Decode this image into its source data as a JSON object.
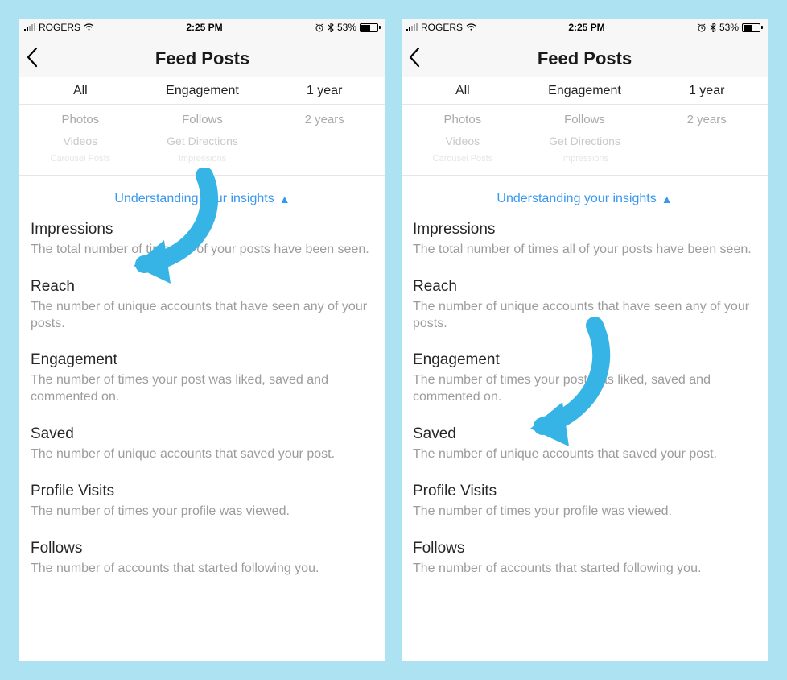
{
  "statusBar": {
    "carrier": "ROGERS",
    "time": "2:25 PM",
    "battery": "53%"
  },
  "header": {
    "title": "Feed Posts"
  },
  "filters": {
    "col1": "All",
    "col2": "Engagement",
    "col3": "1 year"
  },
  "picker": {
    "col1": {
      "line1": "Photos",
      "line2": "Videos",
      "line3": "Carousel Posts"
    },
    "col2": {
      "line1": "Follows",
      "line2": "Get Directions",
      "line3": "Impressions"
    },
    "col3": {
      "line1": "2 years",
      "line2": "",
      "line3": ""
    }
  },
  "insightsLink": "Understanding your insights",
  "definitions": [
    {
      "title": "Impressions",
      "desc": "The total number of times all of your posts have been seen."
    },
    {
      "title": "Reach",
      "desc": "The number of unique accounts that have seen any of your posts."
    },
    {
      "title": "Engagement",
      "desc": "The number of times your post was liked, saved and commented on."
    },
    {
      "title": "Saved",
      "desc": "The number of unique accounts that saved your post."
    },
    {
      "title": "Profile Visits",
      "desc": "The number of times your profile was viewed."
    },
    {
      "title": "Follows",
      "desc": "The number of accounts that started following you."
    }
  ]
}
